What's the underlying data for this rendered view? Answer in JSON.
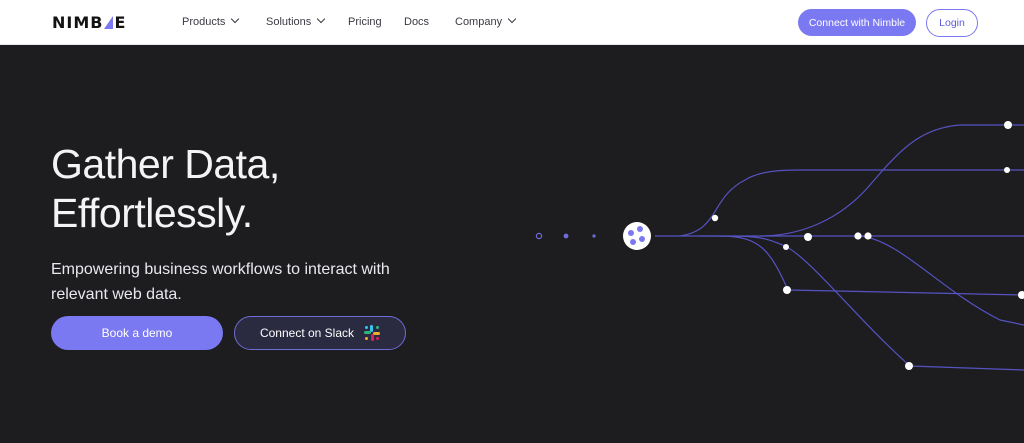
{
  "brand": {
    "name_left": "NIMB",
    "name_right": "E"
  },
  "nav": {
    "items": [
      {
        "label": "Products",
        "has_dropdown": true
      },
      {
        "label": "Solutions",
        "has_dropdown": true
      },
      {
        "label": "Pricing",
        "has_dropdown": false
      },
      {
        "label": "Docs",
        "has_dropdown": false
      },
      {
        "label": "Company",
        "has_dropdown": true
      }
    ],
    "connect_label": "Connect with Nimble",
    "login_label": "Login"
  },
  "hero": {
    "title_line1": "Gather Data,",
    "title_line2": "Effortlessly.",
    "subtitle": "Empowering business workflows to interact with relevant web data.",
    "demo_label": "Book a demo",
    "slack_label": "Connect on Slack"
  },
  "colors": {
    "accent": "#7b79f1",
    "background": "#1d1c1f",
    "nav_bg": "#ffffff",
    "line": "#5a58c8"
  },
  "icons": [
    "chevron-down-icon",
    "slack-icon",
    "network-hub-icon"
  ]
}
